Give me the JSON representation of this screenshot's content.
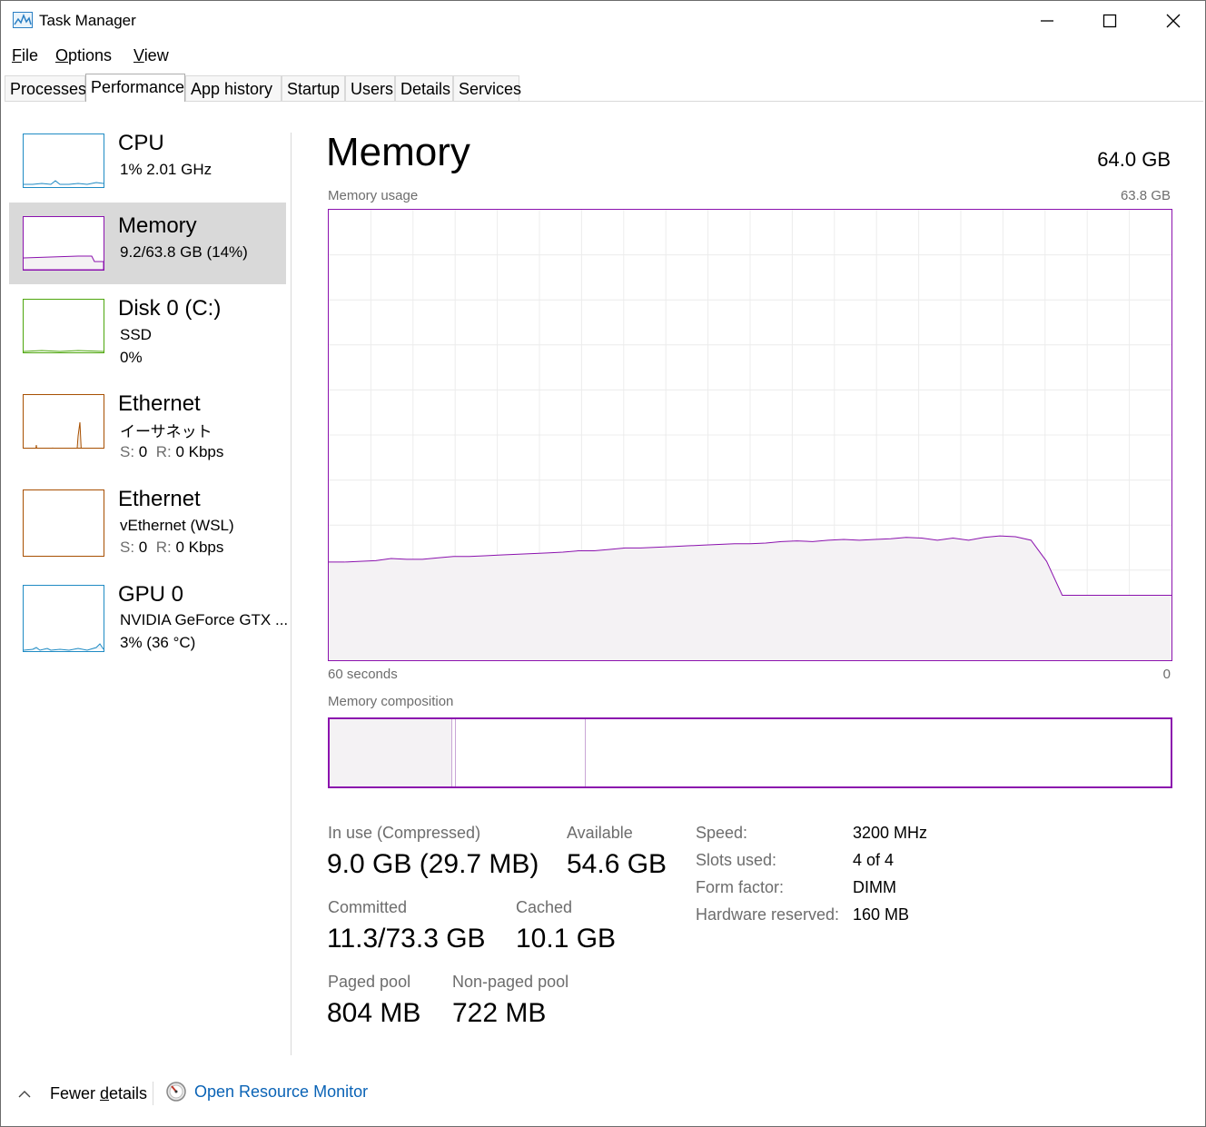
{
  "window": {
    "title": "Task Manager",
    "controls": [
      "minimize-icon",
      "maximize-icon",
      "close-icon"
    ]
  },
  "menu": [
    {
      "label_underlined": "F",
      "label_rest": "ile"
    },
    {
      "label_underlined": "O",
      "label_rest": "ptions"
    },
    {
      "label_underlined": "V",
      "label_rest": "iew"
    }
  ],
  "tabs": [
    "Processes",
    "Performance",
    "App history",
    "Startup",
    "Users",
    "Details",
    "Services"
  ],
  "active_tab": "Performance",
  "sidebar": {
    "items": [
      {
        "title": "CPU",
        "lines": [
          "1%  2.01 GHz"
        ],
        "color": "#1f8bc4"
      },
      {
        "title": "Memory",
        "lines": [
          "9.2/63.8 GB (14%)"
        ],
        "color": "#8b12ae",
        "selected": true
      },
      {
        "title": "Disk 0 (C:)",
        "lines": [
          "SSD",
          "0%"
        ],
        "color": "#4da60c"
      },
      {
        "title": "Ethernet",
        "lines": [
          "イーサネット"
        ],
        "sr": {
          "s_label": "S:",
          "s_val": "0",
          "r_label": "R:",
          "r_val": "0 Kbps"
        },
        "color": "#a74f01"
      },
      {
        "title": "Ethernet",
        "lines": [
          "vEthernet (WSL)"
        ],
        "sr": {
          "s_label": "S:",
          "s_val": "0",
          "r_label": "R:",
          "r_val": "0 Kbps"
        },
        "color": "#a74f01"
      },
      {
        "title": "GPU 0",
        "lines": [
          "NVIDIA GeForce GTX ...",
          "3%  (36 °C)"
        ],
        "color": "#1f8bc4"
      }
    ]
  },
  "main": {
    "title": "Memory",
    "total": "64.0 GB",
    "usage_label": "Memory usage",
    "usage_max": "63.8 GB",
    "time_left": "60 seconds",
    "time_right": "0",
    "composition_label": "Memory composition",
    "composition": {
      "in_use_fraction": 0.145,
      "modified_fraction": 0.004,
      "standby_fraction": 0.155
    },
    "stats": {
      "in_use_label": "In use (Compressed)",
      "in_use_value": "9.0 GB (29.7 MB)",
      "available_label": "Available",
      "available_value": "54.6 GB",
      "committed_label": "Committed",
      "committed_value": "11.3/73.3 GB",
      "cached_label": "Cached",
      "cached_value": "10.1 GB",
      "paged_label": "Paged pool",
      "paged_value": "804 MB",
      "nonpaged_label": "Non-paged pool",
      "nonpaged_value": "722 MB"
    },
    "details": [
      {
        "label": "Speed:",
        "value": "3200 MHz"
      },
      {
        "label": "Slots used:",
        "value": "4 of 4"
      },
      {
        "label": "Form factor:",
        "value": "DIMM"
      },
      {
        "label": "Hardware reserved:",
        "value": "160 MB"
      }
    ]
  },
  "footer": {
    "fewer_prefix": "Fewer ",
    "fewer_underlined": "d",
    "fewer_suffix": "etails",
    "resource_monitor": "Open Resource Monitor"
  },
  "chart_data": {
    "type": "area",
    "title": "Memory usage",
    "xlabel": "",
    "ylabel": "",
    "x_range_labels": [
      "60 seconds",
      "0"
    ],
    "ylim": [
      0,
      63.8
    ],
    "series": [
      {
        "values": [
          13.9,
          13.9,
          14.0,
          14.1,
          14.4,
          14.3,
          14.3,
          14.5,
          14.7,
          14.7,
          14.8,
          14.9,
          15.0,
          15.1,
          15.2,
          15.3,
          15.5,
          15.5,
          15.7,
          15.9,
          15.9,
          16.0,
          16.1,
          16.2,
          16.3,
          16.4,
          16.5,
          16.5,
          16.6,
          16.8,
          16.9,
          16.8,
          17.0,
          17.1,
          17.0,
          17.1,
          17.2,
          17.4,
          17.3,
          17.0,
          17.3,
          17.0,
          17.4,
          17.6,
          17.5,
          17.0,
          14.0,
          9.2,
          9.2,
          9.2,
          9.2,
          9.2,
          9.2,
          9.2,
          9.2
        ]
      }
    ],
    "grid": true
  }
}
